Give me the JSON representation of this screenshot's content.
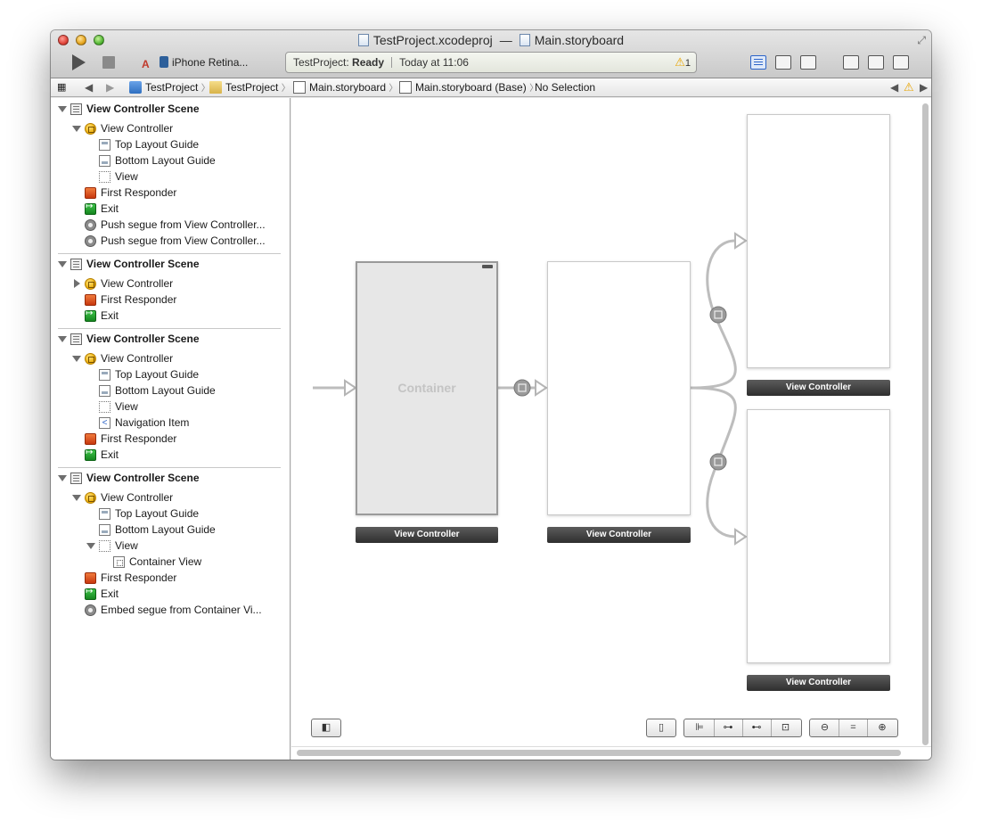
{
  "window": {
    "title_project": "TestProject.xcodeproj",
    "title_separator": "—",
    "title_file": "Main.storyboard",
    "scheme_label": "iPhone Retina...",
    "activity": {
      "project": "TestProject:",
      "status": "Ready",
      "time": "Today at 11:06",
      "warning_count": "1"
    }
  },
  "jumpbar": {
    "items": [
      "TestProject",
      "TestProject",
      "Main.storyboard",
      "Main.storyboard (Base)",
      "No Selection"
    ]
  },
  "outline": {
    "scene1": {
      "title": "View Controller Scene",
      "vc": "View Controller",
      "top_guide": "Top Layout Guide",
      "bottom_guide": "Bottom Layout Guide",
      "view": "View",
      "responder": "First Responder",
      "exit": "Exit",
      "segue1": "Push segue from View Controller...",
      "segue2": "Push segue from View Controller..."
    },
    "scene2": {
      "title": "View Controller Scene",
      "vc": "View Controller",
      "responder": "First Responder",
      "exit": "Exit"
    },
    "scene3": {
      "title": "View Controller Scene",
      "vc": "View Controller",
      "top_guide": "Top Layout Guide",
      "bottom_guide": "Bottom Layout Guide",
      "view": "View",
      "nav_item": "Navigation Item",
      "responder": "First Responder",
      "exit": "Exit"
    },
    "scene4": {
      "title": "View Controller Scene",
      "vc": "View Controller",
      "top_guide": "Top Layout Guide",
      "bottom_guide": "Bottom Layout Guide",
      "view": "View",
      "container_view": "Container View",
      "responder": "First Responder",
      "exit": "Exit",
      "segue": "Embed segue from Container Vi..."
    }
  },
  "canvas": {
    "container_text": "Container",
    "labels": {
      "vc1": "View Controller",
      "vc2": "View Controller",
      "vc3": "View Controller",
      "vc4": "View Controller"
    }
  },
  "colors": {
    "accent": "#2c64c8",
    "warning": "#e8a400",
    "label_bar": "#3a3a3a"
  }
}
